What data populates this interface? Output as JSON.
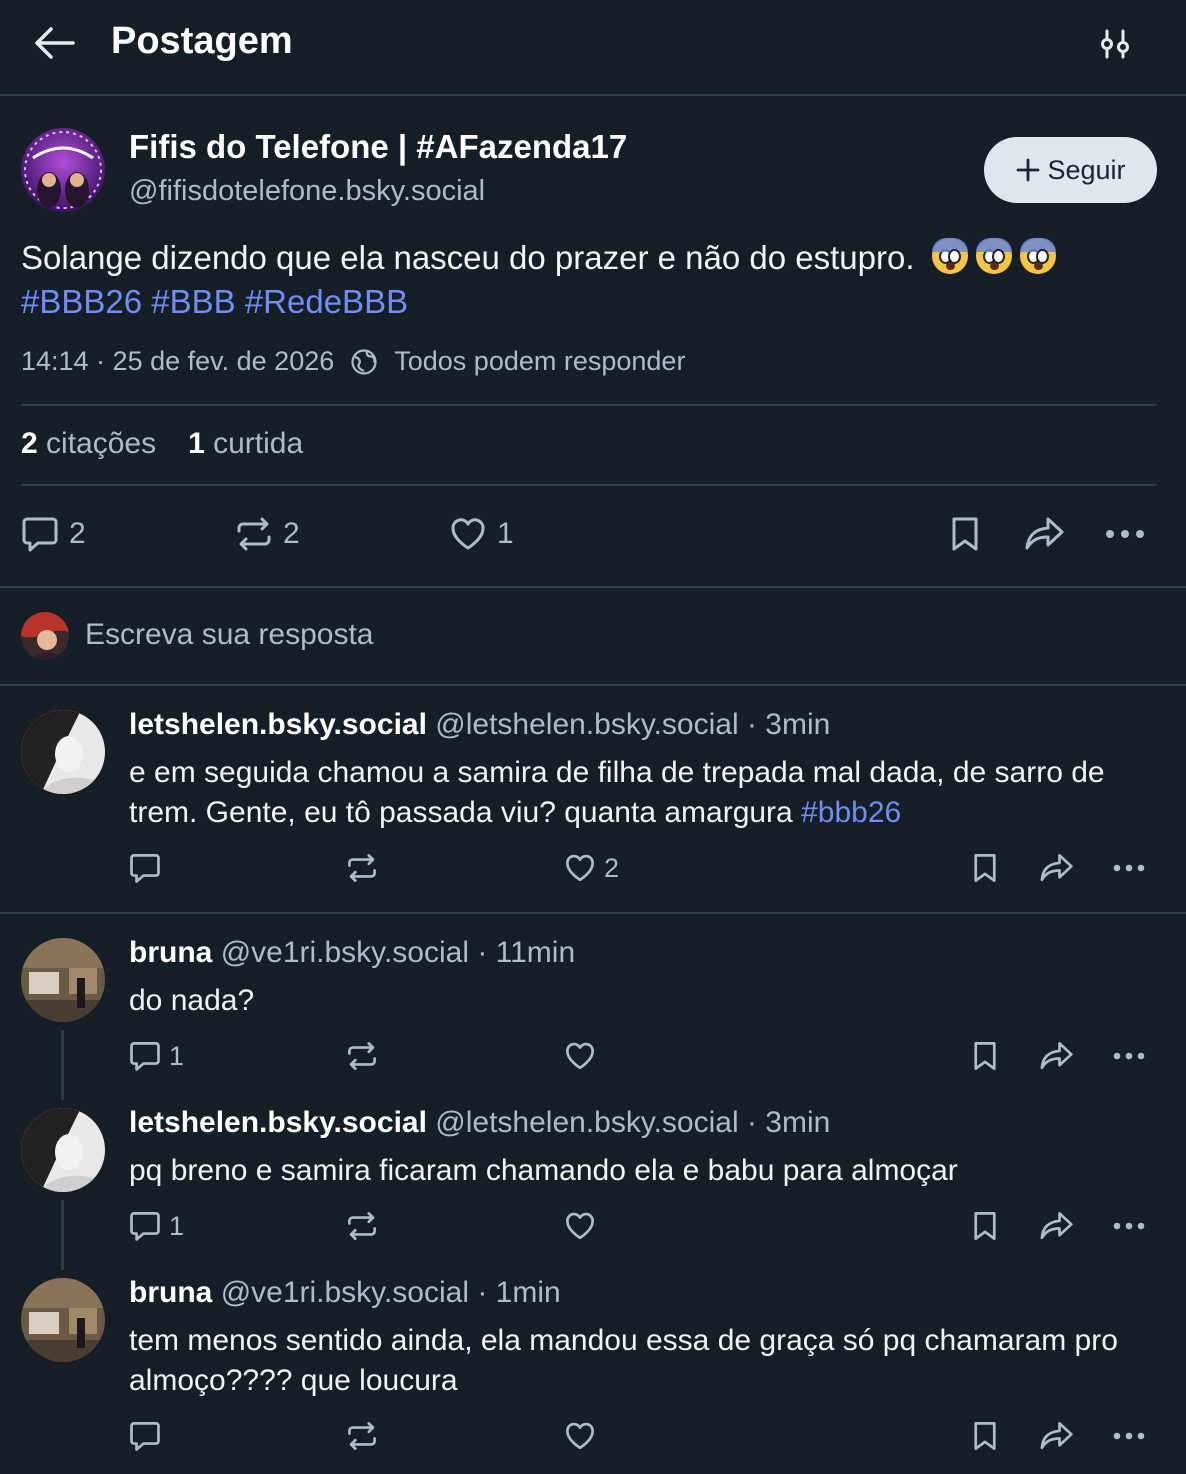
{
  "header": {
    "title": "Postagem"
  },
  "post": {
    "author_name": "Fifis do Telefone | #AFazenda17",
    "author_handle": "@fifisdotelefone.bsky.social",
    "follow_label": "Seguir",
    "text": "Solange dizendo que ela nasceu do prazer e não do estupro.",
    "hashtags": "#BBB26 #BBB #RedeBBB",
    "timestamp": "14:14 · 25 de fev. de 2026",
    "reply_setting": "Todos podem responder",
    "stats": {
      "quotes_count": "2",
      "quotes_label": "citações",
      "likes_count": "1",
      "likes_label": "curtida"
    },
    "actions": {
      "replies": "2",
      "reposts": "2",
      "likes": "1"
    }
  },
  "composer": {
    "placeholder": "Escreva sua resposta"
  },
  "replies": [
    {
      "name": "letshelen.bsky.social",
      "handle": "@letshelen.bsky.social",
      "time": "· 3min",
      "text": "e em seguida chamou a samira de filha de trepada mal dada, de sarro de trem. Gente, eu tô passada viu? quanta amargura",
      "hashtag": "#bbb26",
      "reply_count": "",
      "like_count": "2"
    },
    {
      "name": "bruna",
      "handle": "@ve1ri.bsky.social",
      "time": "· 11min",
      "text": "do nada?",
      "reply_count": "1",
      "like_count": ""
    },
    {
      "name": "letshelen.bsky.social",
      "handle": "@letshelen.bsky.social",
      "time": "· 3min",
      "text": "pq breno e samira ficaram chamando ela e babu para almoçar",
      "reply_count": "1",
      "like_count": ""
    },
    {
      "name": "bruna",
      "handle": "@ve1ri.bsky.social",
      "time": "· 1min",
      "text": "tem menos sentido ainda, ela mandou essa de graça só pq chamaram pro almoço???? que loucura",
      "reply_count": "",
      "like_count": ""
    }
  ],
  "colors": {
    "background": "#161e27",
    "link": "#6f8ff5",
    "muted": "#aebbc9",
    "divider": "#2e3a48"
  }
}
